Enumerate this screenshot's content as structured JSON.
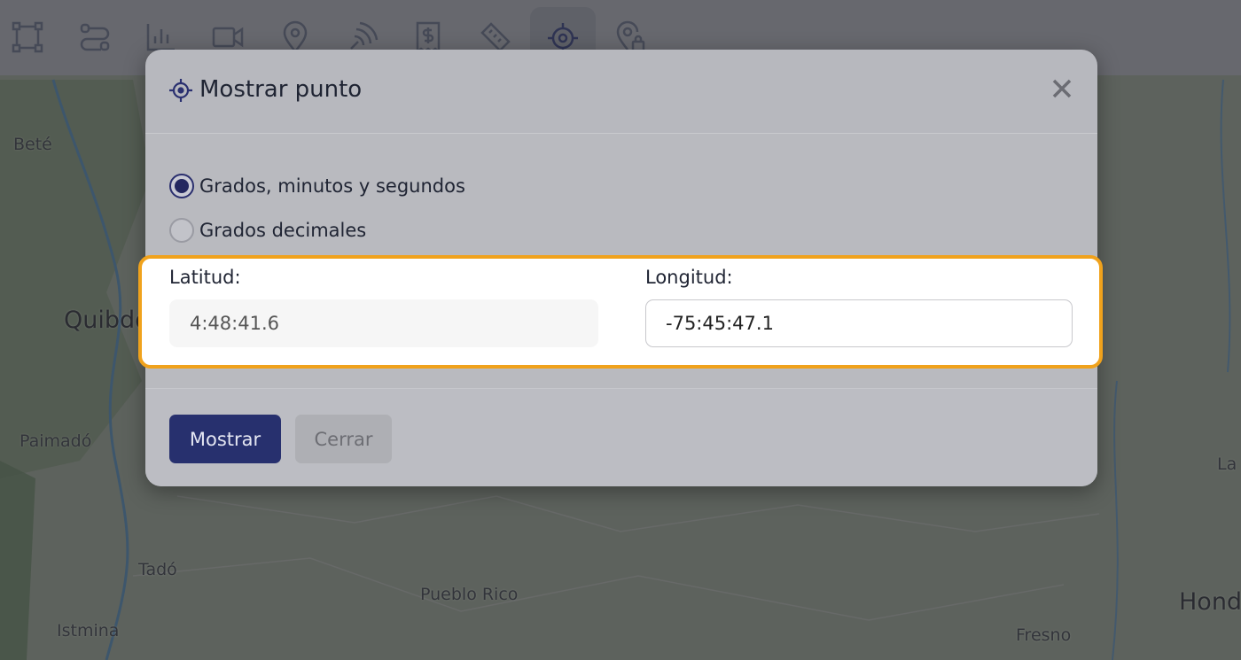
{
  "toolbar": {
    "tools": [
      {
        "icon": "selection-square-icon"
      },
      {
        "icon": "route-icon"
      },
      {
        "icon": "bar-chart-icon"
      },
      {
        "icon": "video-camera-icon"
      },
      {
        "icon": "map-pin-icon"
      },
      {
        "icon": "satellite-signal-icon"
      },
      {
        "icon": "receipt-dollar-icon"
      },
      {
        "icon": "ruler-icon"
      },
      {
        "icon": "crosshair-icon",
        "active": true
      },
      {
        "icon": "location-lock-icon"
      }
    ]
  },
  "map": {
    "labels": [
      "Beté",
      "Quibdó",
      "Paimadó",
      "Tadó",
      "Pueblo Rico",
      "Istmina",
      "Fresno",
      "Hond",
      "La"
    ]
  },
  "modal": {
    "title": "Mostrar punto",
    "options": {
      "dms": "Grados, minutos y segundos",
      "decimal": "Grados decimales",
      "selected": "dms"
    },
    "latitude": {
      "label": "Latitud:",
      "value": "4:48:41.6"
    },
    "longitude": {
      "label": "Longitud:",
      "value": "-75:45:47.1"
    },
    "buttons": {
      "show": "Mostrar",
      "close": "Cerrar"
    }
  },
  "colors": {
    "primary": "#27306e",
    "highlight": "#f0a21c"
  }
}
